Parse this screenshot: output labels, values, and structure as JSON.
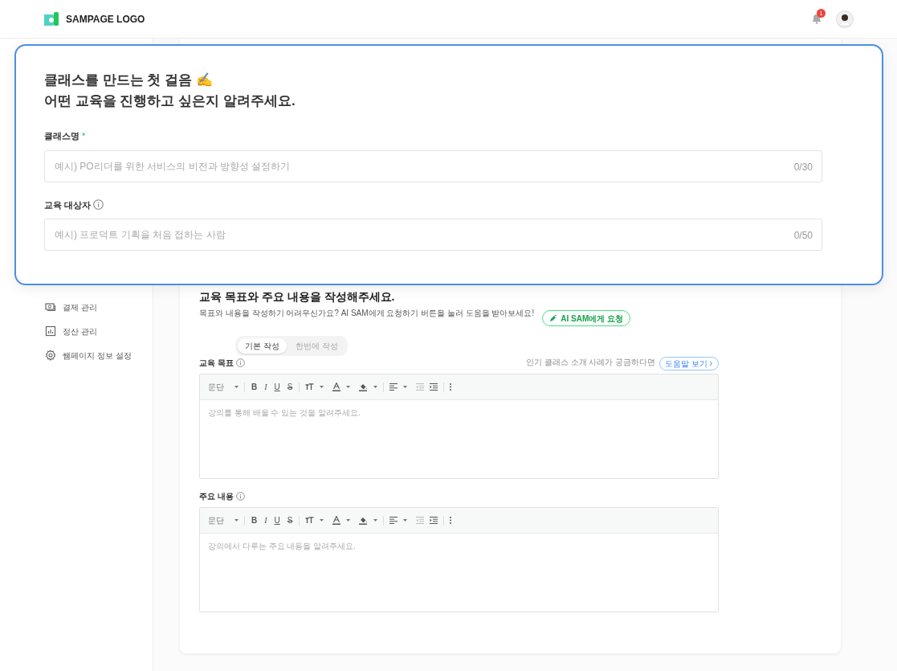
{
  "header": {
    "logo_text": "SAMPAGE LOGO",
    "notification_count": "1"
  },
  "sidebar": {
    "items": [
      {
        "label": "결제 관리",
        "kind": "card"
      },
      {
        "label": "정산 관리",
        "kind": "chart"
      },
      {
        "label": "쌤페이지 정보 설정",
        "kind": "gear"
      }
    ]
  },
  "content": {
    "heading": "교육 목표와 주요 내용을 작성해주세요.",
    "description": "목표와 내용을 작성하기 어려우신가요? AI SAM에게 요청하기 버튼을 눌러 도움을 받아보세요!",
    "ai_button": "AI SAM에게 요청",
    "mode_tabs": [
      {
        "label": "기본 작성",
        "selected": true
      },
      {
        "label": "한번에 작성",
        "selected": false
      }
    ],
    "help_prompt": "인기 클래스 소개 사례가 궁금하다면",
    "help_button": "도움말 보기",
    "editors": [
      {
        "label": "교육 목표",
        "paragraph": "문단",
        "placeholder": "강의를 통해 배울 수 있는 것을 알려주세요.",
        "format_buttons": [
          {
            "kind": "bold",
            "label": "B"
          },
          {
            "kind": "italic",
            "label": "I"
          },
          {
            "kind": "underline",
            "label": "U"
          },
          {
            "kind": "strike",
            "label": "S"
          }
        ]
      },
      {
        "label": "주요 내용",
        "paragraph": "문단",
        "placeholder": "강의에서 다루는 주요 내용을 알려주세요.",
        "format_buttons": [
          {
            "kind": "bold",
            "label": "B"
          },
          {
            "kind": "italic",
            "label": "I"
          },
          {
            "kind": "underline",
            "label": "U"
          },
          {
            "kind": "strike",
            "label": "S"
          }
        ]
      }
    ]
  },
  "overlay": {
    "title_lines": [
      "클래스를 만드는 첫 걸음 ✍️",
      "어떤 교육을 진행하고 싶은지 알려주세요."
    ],
    "fields": [
      {
        "label": "클래스명",
        "required_mark": "*",
        "info": false,
        "placeholder": "예시) PO리더를 위한 서비스의 비전과 방향성 설정하기",
        "counter": "0/30"
      },
      {
        "label": "교육 대상자",
        "info": true,
        "placeholder": "예시) 프로덕트 기획을 처음 접하는 사람",
        "counter": "0/50"
      }
    ]
  }
}
